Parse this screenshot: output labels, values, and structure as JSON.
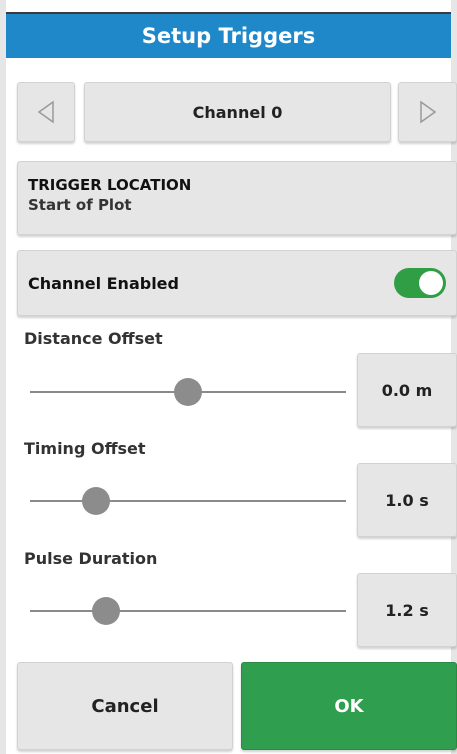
{
  "header": {
    "title": "Setup Triggers"
  },
  "channel_selector": {
    "label": "Channel 0"
  },
  "trigger_location": {
    "title": "TRIGGER LOCATION",
    "value": "Start of Plot"
  },
  "channel_enabled": {
    "label": "Channel Enabled",
    "on": true,
    "color": "#2f9e44"
  },
  "sliders": [
    {
      "label": "Distance Offset",
      "value_text": "0.0 m",
      "position": 0.5
    },
    {
      "label": "Timing Offset",
      "value_text": "1.0 s",
      "position": 0.21
    },
    {
      "label": "Pulse Duration",
      "value_text": "1.2 s",
      "position": 0.24
    }
  ],
  "footer": {
    "cancel_label": "Cancel",
    "ok_label": "OK",
    "ok_color": "#2f9e4f"
  },
  "colors": {
    "header": "#1f88c9",
    "button": "#e6e6e6"
  }
}
